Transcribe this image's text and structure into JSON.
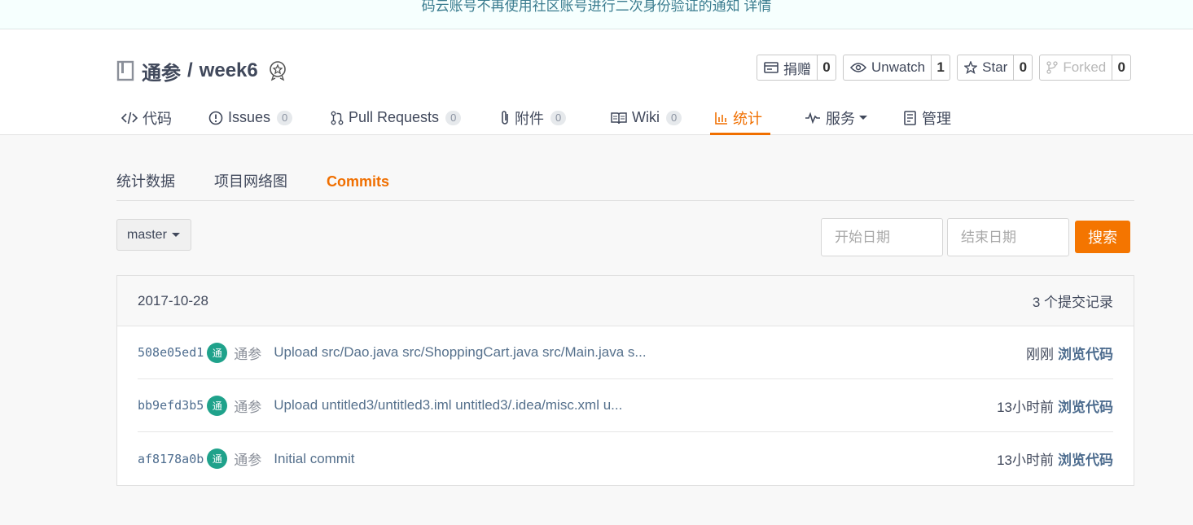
{
  "notice": {
    "text": "码云账号不再使用社区账号进行二次身份验证的通知 详情"
  },
  "repo": {
    "owner": "通参",
    "separator": "/",
    "name": "week6"
  },
  "actions": [
    {
      "label": "捐赠",
      "count": "0",
      "icon": "donate-icon"
    },
    {
      "label": "Unwatch",
      "count": "1",
      "icon": "eye-icon"
    },
    {
      "label": "Star",
      "count": "0",
      "icon": "star-icon"
    },
    {
      "label": "Forked",
      "count": "0",
      "icon": "fork-icon"
    }
  ],
  "tabs": [
    {
      "label": "代码",
      "icon": "code-icon"
    },
    {
      "label": "Issues",
      "count": "0",
      "icon": "issue-icon"
    },
    {
      "label": "Pull Requests",
      "count": "0",
      "icon": "pull-request-icon"
    },
    {
      "label": "附件",
      "count": "0",
      "icon": "attachment-icon"
    },
    {
      "label": "Wiki",
      "count": "0",
      "icon": "wiki-icon"
    },
    {
      "label": "统计",
      "icon": "stats-icon",
      "active": true
    },
    {
      "label": "服务",
      "icon": "pulse-icon"
    },
    {
      "label": "管理",
      "icon": "manage-icon"
    }
  ],
  "subnav": [
    {
      "label": "统计数据"
    },
    {
      "label": "项目网络图"
    },
    {
      "label": "Commits",
      "active": true
    }
  ],
  "branch": {
    "value": "master"
  },
  "search": {
    "start_placeholder": "开始日期",
    "end_placeholder": "结束日期",
    "button": "搜索"
  },
  "commits": {
    "date": "2017-10-28",
    "count_text": "3 个提交记录",
    "rows": [
      {
        "sha": "508e05ed1",
        "avatar": "通",
        "author": "通参",
        "message": "Upload src/Dao.java src/ShoppingCart.java src/Main.java s...",
        "time": "刚刚",
        "browse": "浏览代码"
      },
      {
        "sha": "bb9efd3b5",
        "avatar": "通",
        "author": "通参",
        "message": "Upload untitled3/untitled3.iml untitled3/.idea/misc.xml u...",
        "time": "13小时前",
        "browse": "浏览代码"
      },
      {
        "sha": "af8178a0b",
        "avatar": "通",
        "author": "通参",
        "message": "Initial commit",
        "time": "13小时前",
        "browse": "浏览代码"
      }
    ]
  },
  "colors": {
    "accent": "#f06f00",
    "button": "#f47500",
    "avatar": "#1fa28b",
    "link": "#4e6d8f"
  }
}
